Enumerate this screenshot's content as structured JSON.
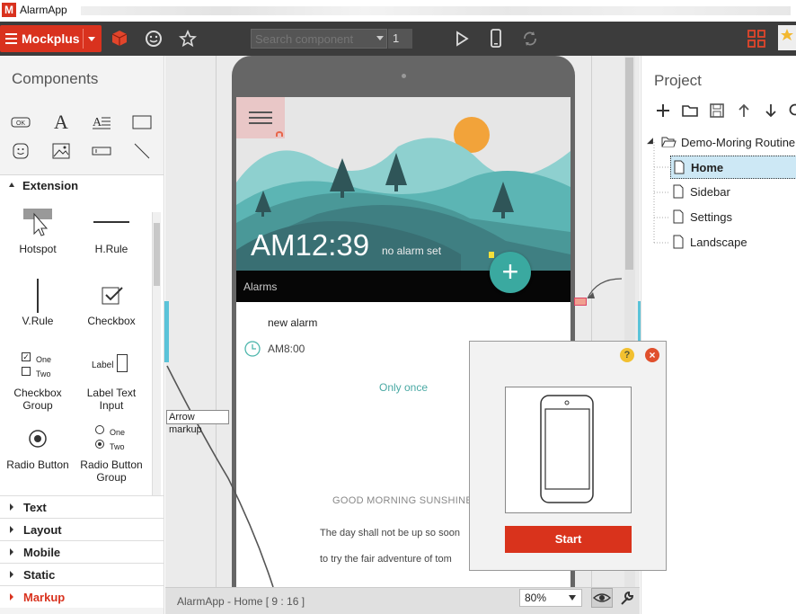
{
  "window": {
    "title": "AlarmApp"
  },
  "toolbar": {
    "brand": "Mockplus",
    "search_placeholder": "Search component",
    "page_number": "1"
  },
  "components_panel": {
    "title": "Components",
    "extension": {
      "header": "Extension",
      "items": [
        {
          "label": "Hotspot"
        },
        {
          "label": "H.Rule"
        },
        {
          "label": "V.Rule"
        },
        {
          "label": "Checkbox"
        },
        {
          "label": "Checkbox\nGroup",
          "line1": "Checkbox",
          "line2": "Group",
          "icon_text1": "One",
          "icon_text2": "Two"
        },
        {
          "label": "Label Text\nInput",
          "line1": "Label Text",
          "line2": "Input",
          "icon_text": "Label"
        },
        {
          "label": "Radio Button"
        },
        {
          "label": "Radio Button\nGroup",
          "line1": "Radio Button",
          "line2": "Group",
          "icon_text1": "One",
          "icon_text2": "Two"
        }
      ]
    },
    "categories": [
      "Text",
      "Layout",
      "Mobile",
      "Static",
      "Markup"
    ]
  },
  "phone_screen": {
    "time": "AM12:39",
    "no_alarm": "no alarm set",
    "alarms_label": "Alarms",
    "alarm_name": "new alarm",
    "alarm_time": "AM8:00",
    "repeat": "Only once",
    "greeting": "GOOD MORNING SUNSHINE",
    "line1": "The day shall not be up so soon",
    "line2": "to try the fair adventure of tom"
  },
  "canvas": {
    "tooltip": "Arrow markup"
  },
  "project_panel": {
    "title": "Project",
    "root": "Demo-Moring Routine",
    "pages": [
      "Home",
      "Sidebar",
      "Settings",
      "Landscape"
    ],
    "selected": "Home"
  },
  "statusbar": {
    "page_info": "AlarmApp - Home [ 9 : 16 ]",
    "zoom": "80%"
  },
  "dialog": {
    "start_label": "Start",
    "help": "?",
    "close": "×"
  },
  "colors": {
    "accent": "#d9321e",
    "teal": "#3aa9a0",
    "toolbar": "#3c3c3c"
  }
}
